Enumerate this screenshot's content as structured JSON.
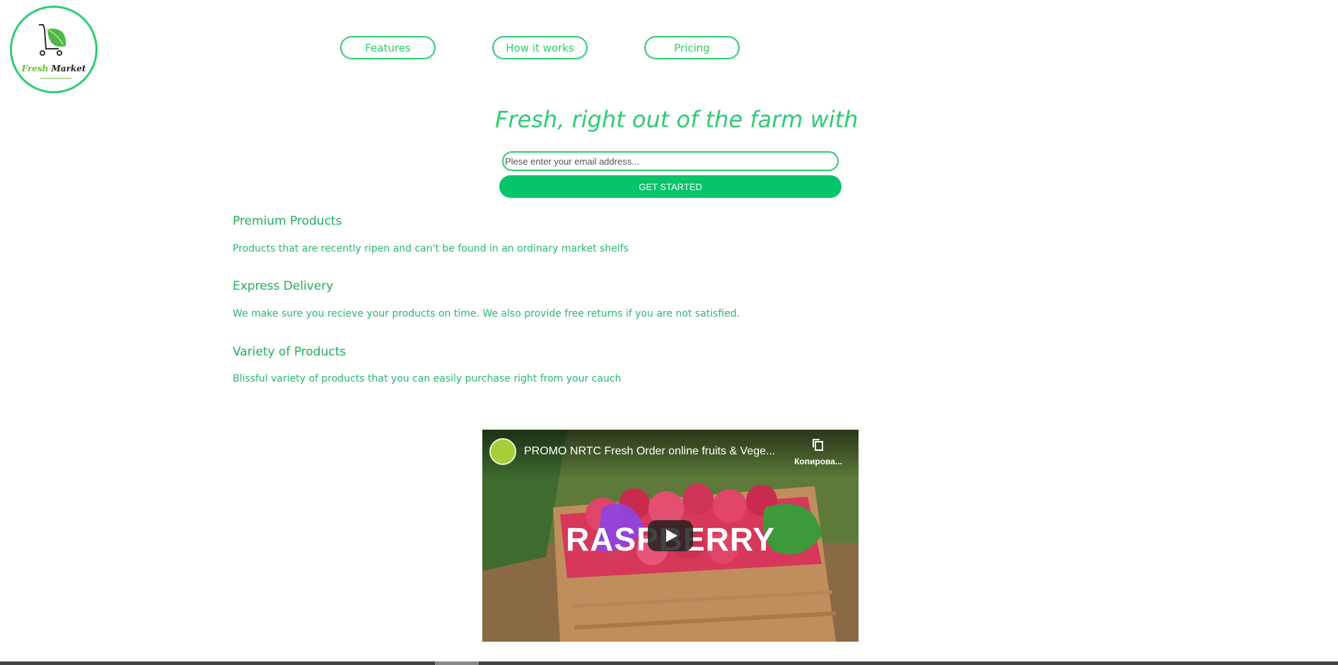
{
  "brand": {
    "name_part1": "Fresh",
    "name_part2": "Market",
    "accent_color": "#2ecc71",
    "button_color": "#06c46a",
    "icon": "shopping-cart-leaf-icon"
  },
  "nav": {
    "items": [
      {
        "label": "Features"
      },
      {
        "label": "How it works"
      },
      {
        "label": "Pricing"
      }
    ]
  },
  "hero": {
    "headline": "Fresh, right out of the farm with",
    "email_placeholder": "Plese enter your email address...",
    "cta_label": "GET STARTED"
  },
  "features": [
    {
      "title": "Premium Products",
      "description": "Products that are recently ripen and can't be found in an ordinary market shelfs"
    },
    {
      "title": "Express Delivery",
      "description": "We make sure you recieve your products on time. We also provide free returns if you are not satisfied."
    },
    {
      "title": "Variety of Products",
      "description": "Blissful variety of products that you can easily purchase right from your cauch"
    }
  ],
  "video": {
    "title": "PROMO NRTC Fresh Order online fruits & Vege...",
    "copy_label": "Копирова...",
    "overlay_text": "RASPBERRY",
    "play_icon": "play-icon",
    "copy_icon": "copy-icon"
  }
}
